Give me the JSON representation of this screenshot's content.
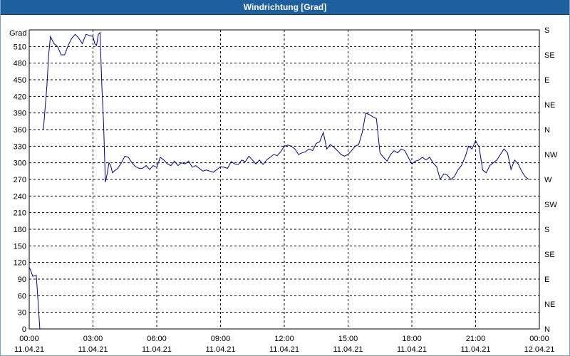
{
  "window": {
    "title": "Windrichtung [Grad]"
  },
  "colors": {
    "titlebar": "#1e5f9e",
    "series": "#0000a0",
    "grid": "#000000"
  },
  "chart_data": {
    "type": "line",
    "title": "Windrichtung [Grad]",
    "ylabel": "Grad",
    "xlim": [
      "2021-04-11 00:00",
      "2021-04-12 00:00"
    ],
    "ylim": [
      0,
      540
    ],
    "y_ticks": [
      0,
      30,
      60,
      90,
      120,
      150,
      180,
      210,
      240,
      270,
      300,
      330,
      360,
      390,
      420,
      450,
      480,
      510
    ],
    "y2_ticks": [
      "N",
      "NE",
      "E",
      "SE",
      "S",
      "SW",
      "W",
      "NW",
      "N",
      "NE",
      "E",
      "SE",
      "S"
    ],
    "x_ticks": [
      {
        "time": "00:00",
        "date": "11.04.21"
      },
      {
        "time": "03:00",
        "date": "11.04.21"
      },
      {
        "time": "06:00",
        "date": "11.04.21"
      },
      {
        "time": "09:00",
        "date": "11.04.21"
      },
      {
        "time": "12:00",
        "date": "11.04.21"
      },
      {
        "time": "15:00",
        "date": "11.04.21"
      },
      {
        "time": "18:00",
        "date": "11.04.21"
      },
      {
        "time": "21:00",
        "date": "11.04.21"
      },
      {
        "time": "00:00",
        "date": "12.04.21"
      }
    ],
    "grid": true,
    "series": [
      {
        "segments": [
          [
            [
              "00:00",
              112
            ],
            [
              "00:05",
              104
            ],
            [
              "00:10",
              95
            ],
            [
              "00:20",
              97
            ],
            [
              "00:25",
              50
            ],
            [
              "00:30",
              0
            ]
          ],
          [
            [
              "00:40",
              360
            ],
            [
              "00:50",
              440
            ],
            [
              "00:55",
              495
            ],
            [
              "01:00",
              528
            ],
            [
              "01:10",
              515
            ],
            [
              "01:20",
              510
            ],
            [
              "01:30",
              495
            ],
            [
              "01:40",
              495
            ],
            [
              "01:50",
              512
            ],
            [
              "02:00",
              525
            ],
            [
              "02:10",
              532
            ],
            [
              "02:20",
              525
            ],
            [
              "02:30",
              515
            ],
            [
              "02:40",
              532
            ],
            [
              "02:50",
              530
            ],
            [
              "03:00",
              528
            ],
            [
              "03:05",
              515
            ],
            [
              "03:10",
              512
            ],
            [
              "03:15",
              532
            ],
            [
              "03:20",
              535
            ],
            [
              "03:25",
              440
            ],
            [
              "03:30",
              370
            ],
            [
              "03:35",
              265
            ],
            [
              "03:40",
              280
            ],
            [
              "03:45",
              300
            ],
            [
              "03:50",
              295
            ],
            [
              "03:55",
              282
            ],
            [
              "04:00",
              285
            ],
            [
              "04:10",
              290
            ],
            [
              "04:20",
              300
            ],
            [
              "04:30",
              312
            ],
            [
              "04:40",
              310
            ],
            [
              "04:50",
              300
            ],
            [
              "05:00",
              293
            ],
            [
              "05:10",
              290
            ],
            [
              "05:20",
              290
            ],
            [
              "05:30",
              295
            ],
            [
              "05:40",
              288
            ],
            [
              "05:50",
              295
            ],
            [
              "06:00",
              292
            ],
            [
              "06:10",
              310
            ],
            [
              "06:20",
              305
            ],
            [
              "06:30",
              298
            ],
            [
              "06:40",
              295
            ],
            [
              "06:50",
              303
            ],
            [
              "07:00",
              295
            ],
            [
              "07:10",
              300
            ],
            [
              "07:20",
              298
            ],
            [
              "07:30",
              303
            ],
            [
              "07:40",
              292
            ],
            [
              "07:50",
              295
            ],
            [
              "08:00",
              290
            ],
            [
              "08:10",
              285
            ],
            [
              "08:20",
              287
            ],
            [
              "08:30",
              285
            ],
            [
              "08:40",
              283
            ],
            [
              "08:50",
              288
            ],
            [
              "09:00",
              293
            ],
            [
              "09:10",
              292
            ],
            [
              "09:20",
              290
            ],
            [
              "09:30",
              302
            ],
            [
              "09:40",
              298
            ],
            [
              "09:50",
              297
            ],
            [
              "10:00",
              305
            ],
            [
              "10:10",
              302
            ],
            [
              "10:20",
              312
            ],
            [
              "10:30",
              305
            ],
            [
              "10:40",
              298
            ],
            [
              "10:50",
              305
            ],
            [
              "11:00",
              297
            ],
            [
              "11:10",
              305
            ],
            [
              "11:20",
              310
            ],
            [
              "11:30",
              315
            ],
            [
              "11:40",
              313
            ],
            [
              "11:50",
              320
            ],
            [
              "12:00",
              330
            ],
            [
              "12:10",
              332
            ],
            [
              "12:20",
              330
            ],
            [
              "12:30",
              325
            ],
            [
              "12:40",
              315
            ],
            [
              "12:50",
              318
            ],
            [
              "13:00",
              320
            ],
            [
              "13:10",
              325
            ],
            [
              "13:20",
              322
            ],
            [
              "13:30",
              335
            ],
            [
              "13:40",
              338
            ],
            [
              "13:50",
              355
            ],
            [
              "14:00",
              325
            ],
            [
              "14:10",
              333
            ],
            [
              "14:20",
              328
            ],
            [
              "14:30",
              322
            ],
            [
              "14:40",
              315
            ],
            [
              "14:50",
              312
            ],
            [
              "15:00",
              315
            ],
            [
              "15:10",
              322
            ],
            [
              "15:20",
              330
            ],
            [
              "15:30",
              333
            ],
            [
              "15:40",
              355
            ],
            [
              "15:50",
              390
            ],
            [
              "16:00",
              387
            ],
            [
              "16:10",
              383
            ],
            [
              "16:20",
              380
            ],
            [
              "16:30",
              318
            ],
            [
              "16:40",
              310
            ],
            [
              "16:50",
              303
            ],
            [
              "17:00",
              315
            ],
            [
              "17:10",
              322
            ],
            [
              "17:20",
              318
            ],
            [
              "17:30",
              325
            ],
            [
              "17:40",
              322
            ],
            [
              "17:50",
              310
            ],
            [
              "18:00",
              298
            ],
            [
              "18:10",
              303
            ],
            [
              "18:20",
              305
            ],
            [
              "18:30",
              310
            ],
            [
              "18:40",
              305
            ],
            [
              "18:50",
              310
            ],
            [
              "19:00",
              300
            ],
            [
              "19:10",
              293
            ],
            [
              "19:20",
              270
            ],
            [
              "19:30",
              280
            ],
            [
              "19:40",
              278
            ],
            [
              "19:50",
              270
            ],
            [
              "20:00",
              275
            ],
            [
              "20:10",
              287
            ],
            [
              "20:20",
              295
            ],
            [
              "20:30",
              310
            ],
            [
              "20:40",
              330
            ],
            [
              "20:50",
              325
            ],
            [
              "21:00",
              340
            ],
            [
              "21:10",
              328
            ],
            [
              "21:20",
              287
            ],
            [
              "21:30",
              282
            ],
            [
              "21:40",
              295
            ],
            [
              "21:50",
              300
            ],
            [
              "22:00",
              305
            ],
            [
              "22:10",
              315
            ],
            [
              "22:20",
              325
            ],
            [
              "22:30",
              318
            ],
            [
              "22:40",
              288
            ],
            [
              "22:50",
              305
            ],
            [
              "23:00",
              298
            ],
            [
              "23:10",
              285
            ],
            [
              "23:20",
              275
            ],
            [
              "23:30",
              270
            ]
          ]
        ]
      }
    ]
  }
}
